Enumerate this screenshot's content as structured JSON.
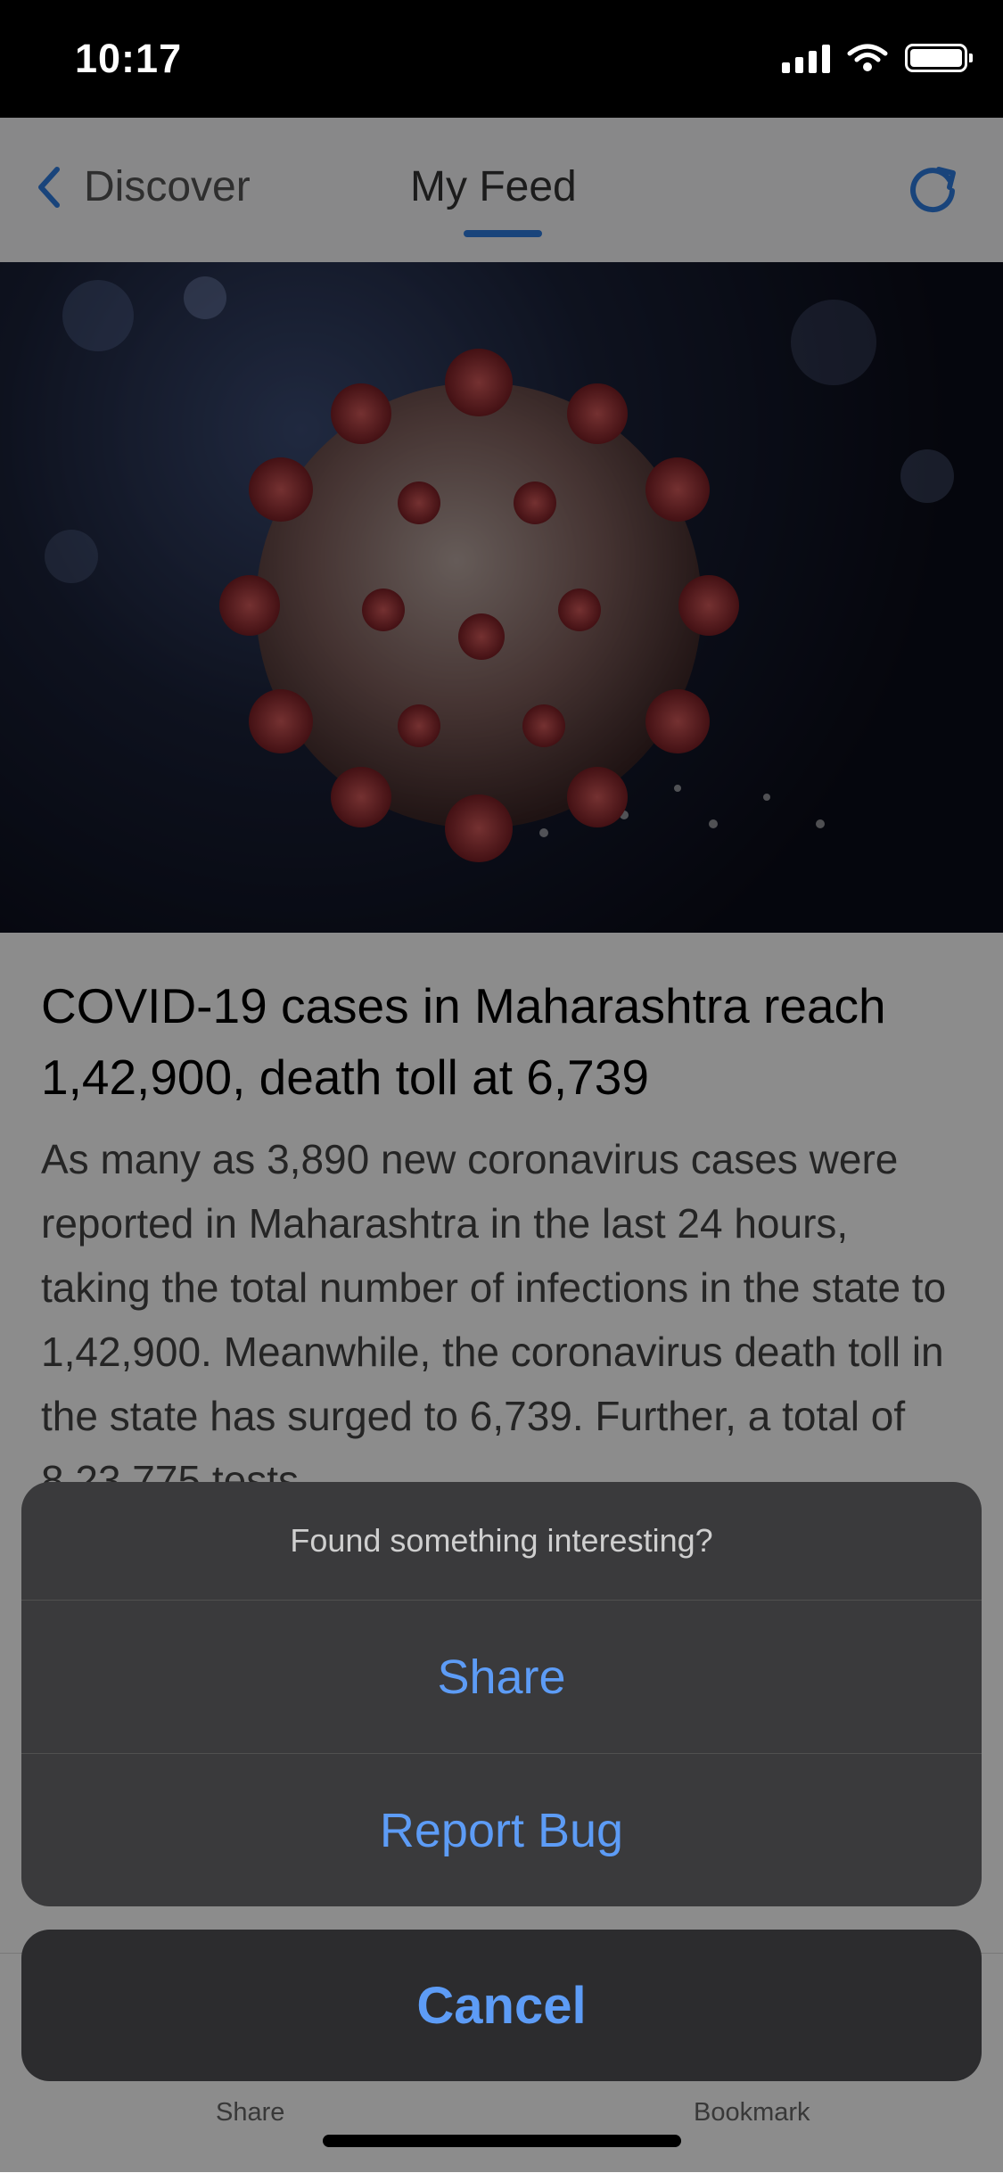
{
  "status_bar": {
    "time": "10:17"
  },
  "nav": {
    "back_label": "Discover",
    "active_tab": "My Feed",
    "accent": "#2f7de1"
  },
  "article": {
    "headline": "COVID-19 cases in Maharashtra reach 1,42,900, death toll at 6,739",
    "summary": "As many as 3,890 new coronavirus cases were reported in Maharashtra in the last 24 hours, taking the total number of infections in the state to 1,42,900. Meanwhile, the coronavirus death toll in the state has surged to 6,739. Further, a total of 8,23,775 tests"
  },
  "bottom_bar": {
    "share_label": "Share",
    "bookmark_label": "Bookmark"
  },
  "action_sheet": {
    "title": "Found something interesting?",
    "share": "Share",
    "report_bug": "Report Bug",
    "cancel": "Cancel",
    "action_color": "#5d9cf6"
  },
  "icons": {
    "back": "chevron-left-icon",
    "refresh": "refresh-icon",
    "hero": "coronavirus-image"
  }
}
